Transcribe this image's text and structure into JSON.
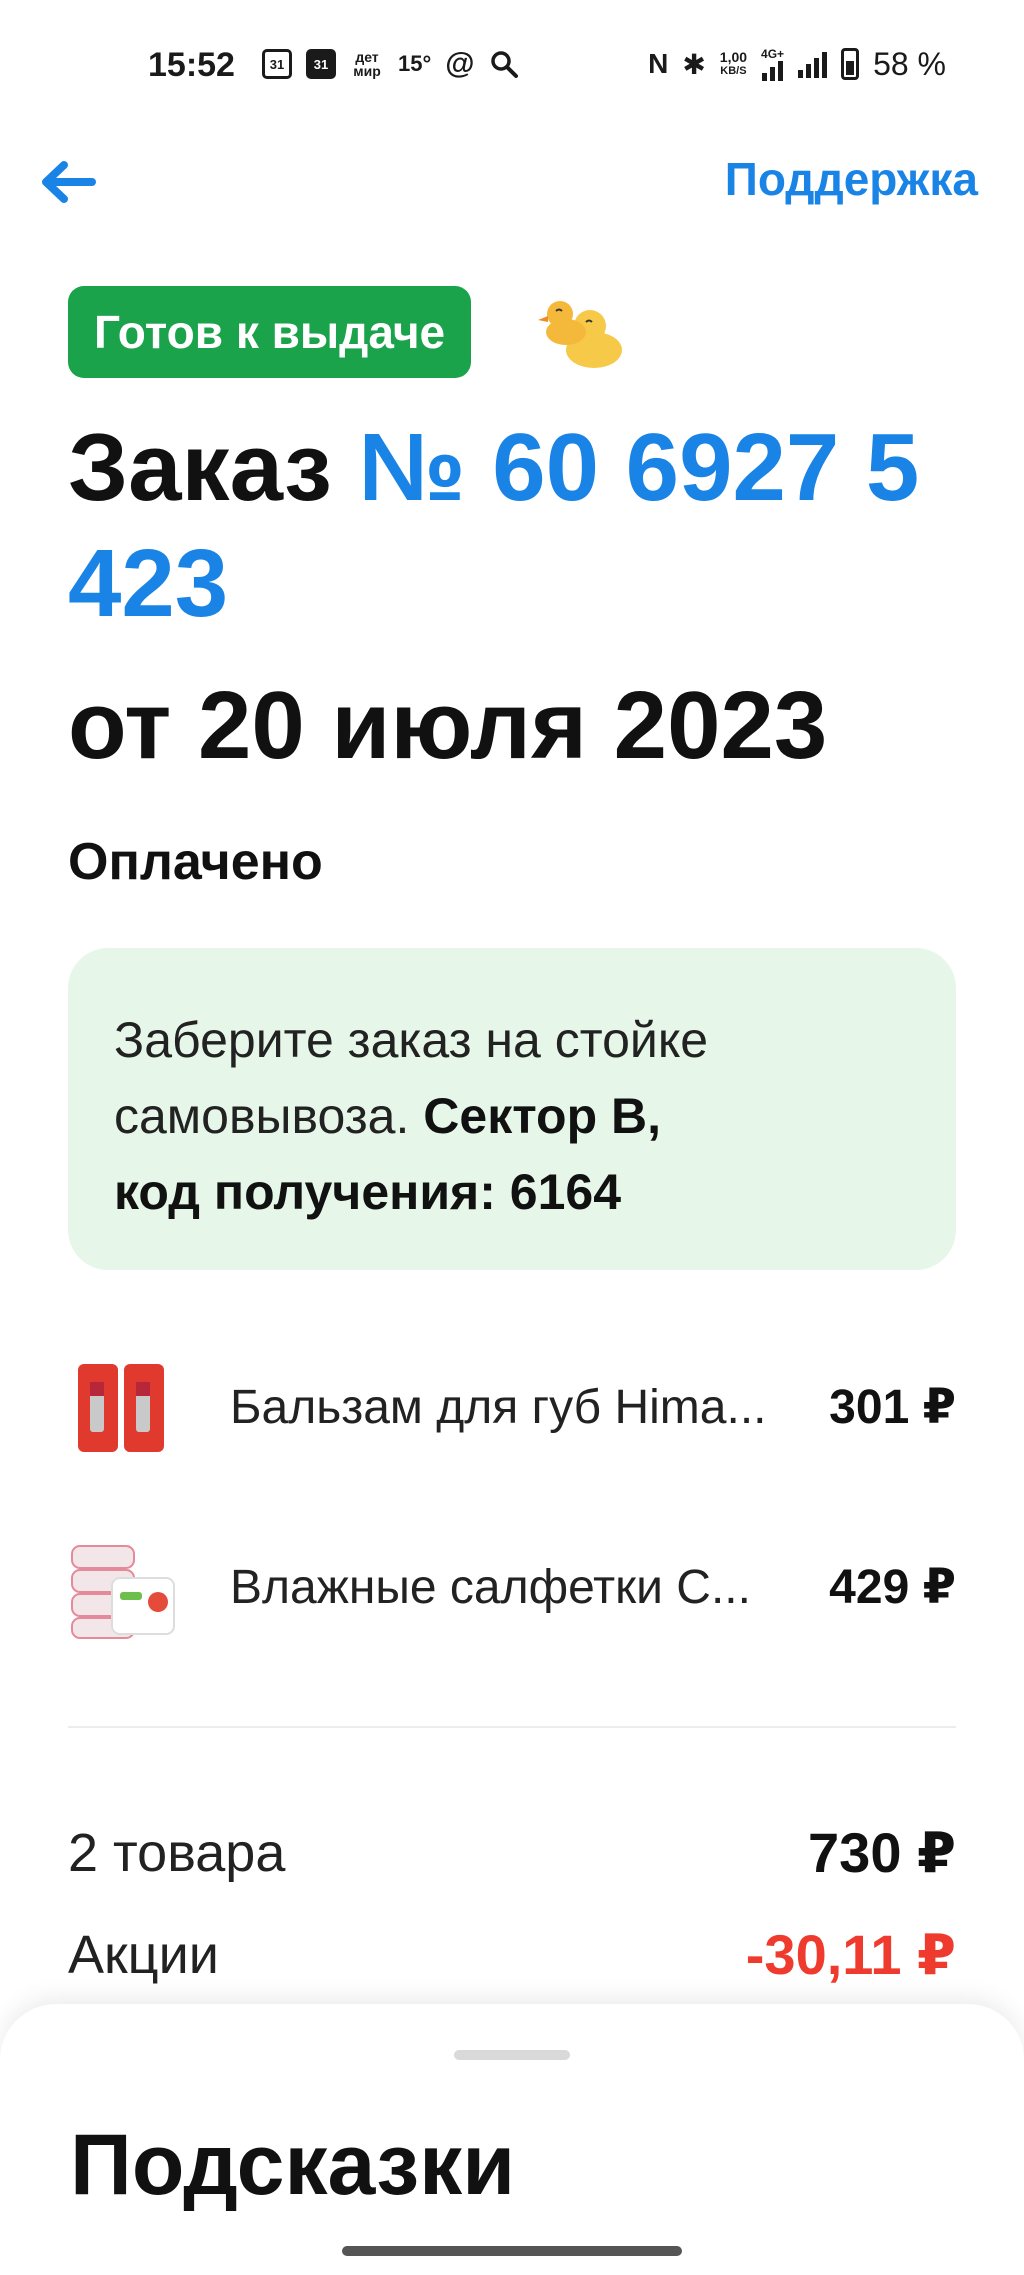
{
  "status_bar": {
    "time": "15:52",
    "calendar1": "31",
    "calendar2": "31",
    "app_label": "дет мир",
    "temperature": "15°",
    "network_speed_top": "1,00",
    "network_speed_unit": "KB/S",
    "network_type": "4G+",
    "battery_percent": "58 %"
  },
  "header": {
    "support_label": "Поддержка"
  },
  "order": {
    "status_badge": "Готов к выдаче",
    "title_prefix": "Заказ",
    "number": "№ 60 6927 5 423",
    "date": "от 20 июля 2023",
    "payment_status": "Оплачено"
  },
  "pickup_info": {
    "text_before": "Заберите заказ на стойке самовывоза.",
    "sector": "Сектор B,",
    "code_label": "код получения: 6164"
  },
  "items": [
    {
      "name": "Бальзам для губ Hima...",
      "price": "301 ₽"
    },
    {
      "name": "Влажные салфетки С...",
      "price": "429 ₽"
    }
  ],
  "summary": {
    "count_label": "2 товара",
    "count_total": "730 ₽",
    "promo_label": "Акции",
    "promo_value": "-30,11 ₽"
  },
  "sheet": {
    "title": "Подсказки"
  },
  "colors": {
    "accent_blue": "#1a84e6",
    "status_green": "#1aa34a",
    "info_bg": "#e6f7ea",
    "discount_red": "#ee3b2e"
  }
}
